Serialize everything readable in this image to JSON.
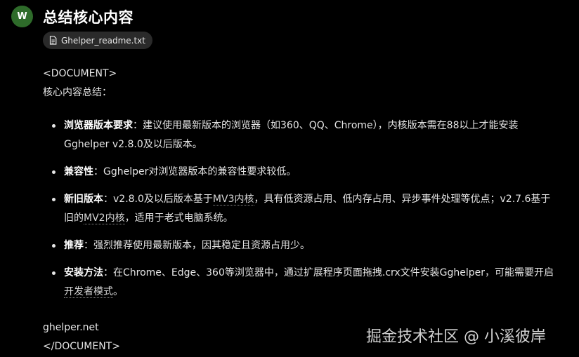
{
  "header": {
    "avatar_letter": "W",
    "title": "总结核心内容"
  },
  "attachment": {
    "filename": "Ghelper_readme.txt"
  },
  "doc": {
    "open_tag": "<DOCUMENT>",
    "summary_label": "核心内容总结：",
    "items": [
      {
        "key": "浏览器版本要求",
        "text": "：建议使用最新版本的浏览器（如360、QQ、Chrome），内核版本需在88以上才能安装Gghelper v2.8.0及以后版本。"
      },
      {
        "key": "兼容性",
        "text": "：Gghelper对浏览器版本的兼容性要求较低。"
      },
      {
        "key": "新旧版本",
        "text_a": "：v2.8.0及以后版本基于",
        "link_a": "MV3内核",
        "text_b": "，具有低资源占用、低内存占用、异步事件处理等优点；v2.7.6基于旧的",
        "link_b": "MV2内核",
        "text_c": "，适用于老式电脑系统。"
      },
      {
        "key": "推荐",
        "text": "：强烈推荐使用最新版本，因其稳定且资源占用少。"
      },
      {
        "key": "安装方法",
        "text_a": "：在Chrome、Edge、360等浏览器中，通过扩展程序页面拖拽.crx文件安装Gghelper，可能需要开启",
        "link": "开发者模式",
        "text_b": "。"
      }
    ],
    "footer_text": "ghelper.net",
    "close_tag": "</DOCUMENT>"
  },
  "watermark": "掘金技术社区 @ 小溪彼岸",
  "colors": {
    "background": "#000000",
    "avatar": "#2e6b2a",
    "chip": "#2a2a2a"
  }
}
